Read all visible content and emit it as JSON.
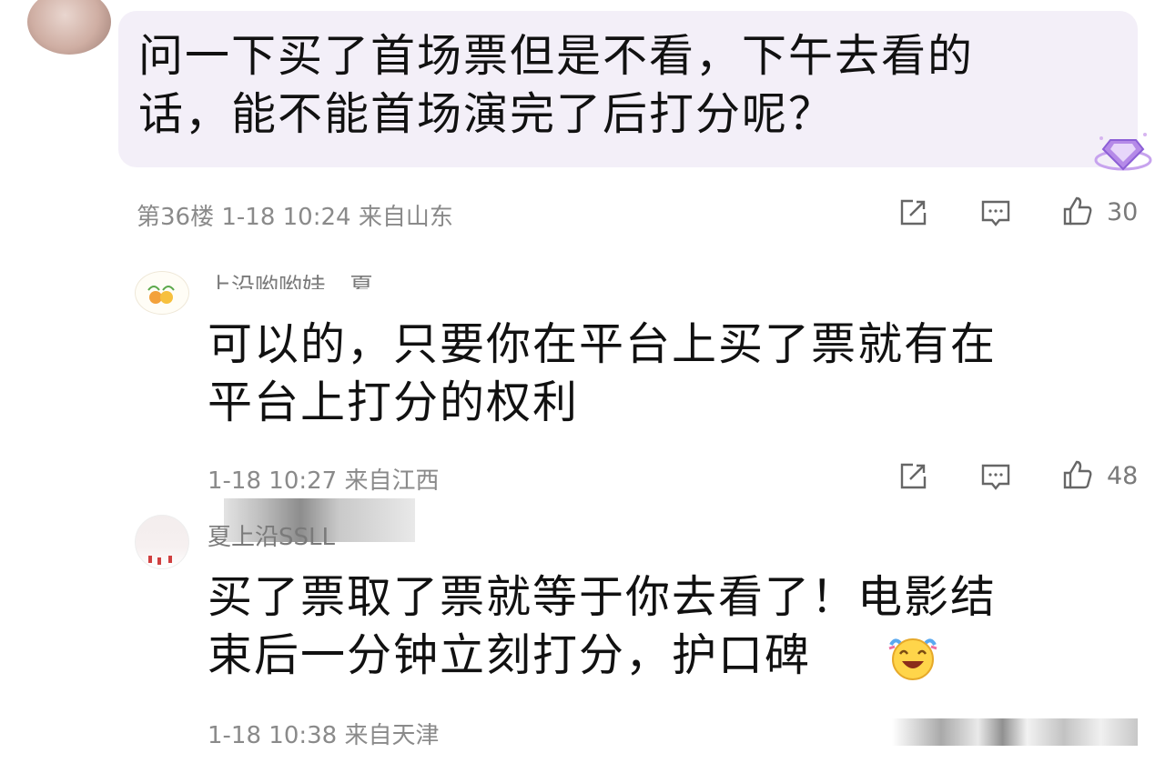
{
  "comments": [
    {
      "text_line1": "问一下买了首场票但是不看，下午去看的",
      "text_line2": "话，能不能首场演完了后打分呢？",
      "meta": "第36楼 1-18 10:24 来自山东",
      "likes": "30"
    },
    {
      "username": "上沿哟哟娃…夏",
      "text_line1": "可以的，只要你在平台上买了票就有在",
      "text_line2": "平台上打分的权利",
      "meta": "1-18 10:27 来自江西",
      "likes": "48"
    },
    {
      "username": "夏上沿SSLL",
      "text_line1": "买了票取了票就等于你去看了！电影结",
      "text_line2": "束后一分钟立刻打分，护口碑",
      "meta": "1-18 10:38 来自天津"
    }
  ],
  "icons": {
    "share": "share-icon",
    "comment": "comment-icon",
    "like": "thumbs-up-icon",
    "badge": "diamond-badge-icon",
    "emoji": "laughing-emoji-icon"
  },
  "colors": {
    "bubble": "#f3eff8",
    "meta_text": "#8a8a8a",
    "badge": "#a77be0"
  }
}
